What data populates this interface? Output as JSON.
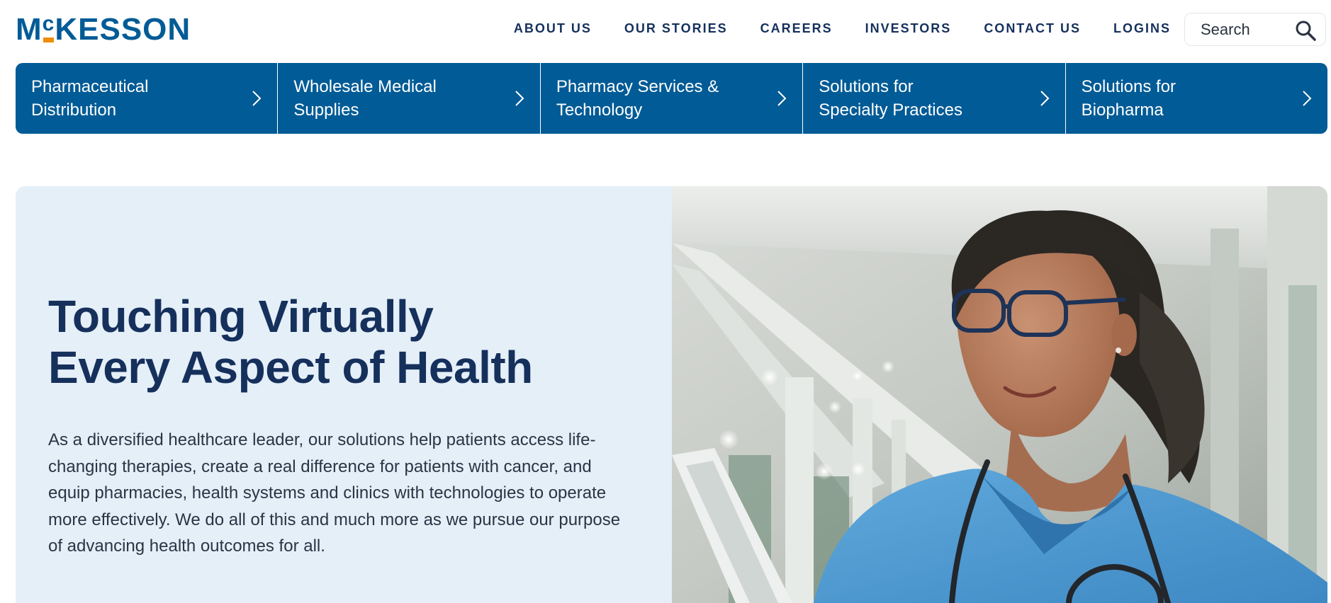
{
  "header": {
    "logo_text": "McKESSON",
    "nav": [
      "ABOUT US",
      "OUR STORIES",
      "CAREERS",
      "INVESTORS",
      "CONTACT US",
      "LOGINS"
    ],
    "search_placeholder": "Search"
  },
  "categories": [
    {
      "line1": "Pharmaceutical",
      "line2": "Distribution"
    },
    {
      "line1": "Wholesale Medical",
      "line2": "Supplies"
    },
    {
      "line1": "Pharmacy Services &",
      "line2": "Technology"
    },
    {
      "line1": "Solutions for",
      "line2": "Specialty Practices"
    },
    {
      "line1": "Solutions for",
      "line2": "Biopharma"
    }
  ],
  "hero": {
    "title_line1": "Touching Virtually",
    "title_line2": "Every Aspect of Health",
    "body": "As a diversified healthcare leader, our solutions help patients access life-changing therapies, create a real difference for patients with cancer, and equip pharmacies, health systems and clinics with technologies to operate more effectively. We do all of this and much more as we pursue our purpose of advancing health outcomes for all."
  },
  "colors": {
    "brand_blue": "#005b96",
    "brand_orange": "#f08c00",
    "navy_text": "#16305c",
    "hero_bg": "#e5eff8"
  }
}
